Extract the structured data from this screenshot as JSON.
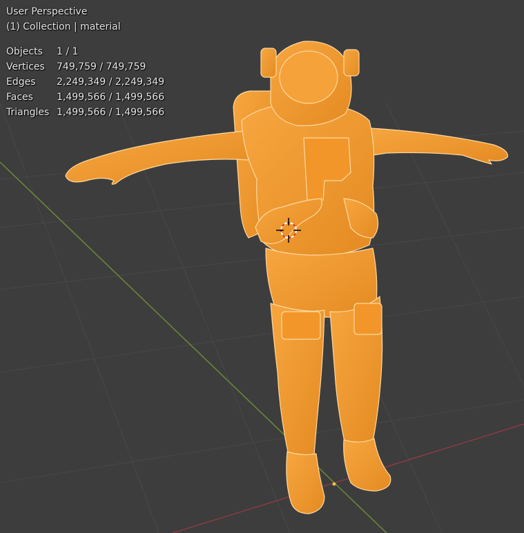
{
  "viewport": {
    "view_name": "User Perspective",
    "collection_info": "(1) Collection | material"
  },
  "stats": [
    {
      "label": "Objects",
      "value": "1 / 1"
    },
    {
      "label": "Vertices",
      "value": "749,759 / 749,759"
    },
    {
      "label": "Edges",
      "value": "2,249,349 / 2,249,349"
    },
    {
      "label": "Faces",
      "value": "1,499,566 / 1,499,566"
    },
    {
      "label": "Triangles",
      "value": "1,499,566 / 1,499,566"
    }
  ],
  "colors": {
    "background": "#3d3d3d",
    "grid": "#494949",
    "y_axis": "#6d8a3a",
    "x_axis": "#8c3a44",
    "model_fill": "#f39a2e",
    "model_outline": "#ffd9a0"
  },
  "icons": {
    "cursor": "3d-cursor-icon"
  }
}
